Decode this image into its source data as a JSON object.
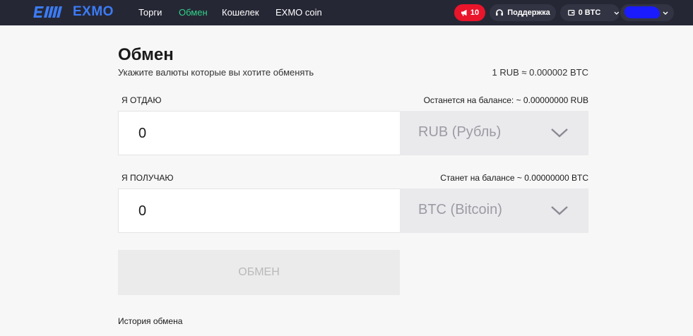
{
  "header": {
    "logo_text": "EXMO",
    "nav": [
      {
        "label": "Торги"
      },
      {
        "label": "Обмен"
      },
      {
        "label": "Кошелек"
      },
      {
        "label": "EXMO coin"
      }
    ],
    "notifications_count": "10",
    "support_label": "Поддержка",
    "wallet_balance": "0 BTC"
  },
  "exchange": {
    "title": "Обмен",
    "subtitle": "Укажите валюты которые вы хотите обменять",
    "rate": "1 RUB ≈ 0.000002 BTC",
    "give": {
      "label": "Я ОТДАЮ",
      "balance_info": "Останется на балансе: ~ 0.00000000 RUB",
      "amount": "0",
      "currency": "RUB (Рубль)"
    },
    "receive": {
      "label": "Я ПОЛУЧАЮ",
      "balance_info": "Станет на балансе ~ 0.00000000 BTC",
      "amount": "0",
      "currency": "BTC (Bitcoin)"
    },
    "submit_label": "ОБМЕН",
    "history_label": "История обмена"
  },
  "colors": {
    "topbar": "#262735",
    "brand_blue": "#3b7cf5",
    "active_nav": "#2fd388",
    "notify_red": "#e8152b"
  }
}
